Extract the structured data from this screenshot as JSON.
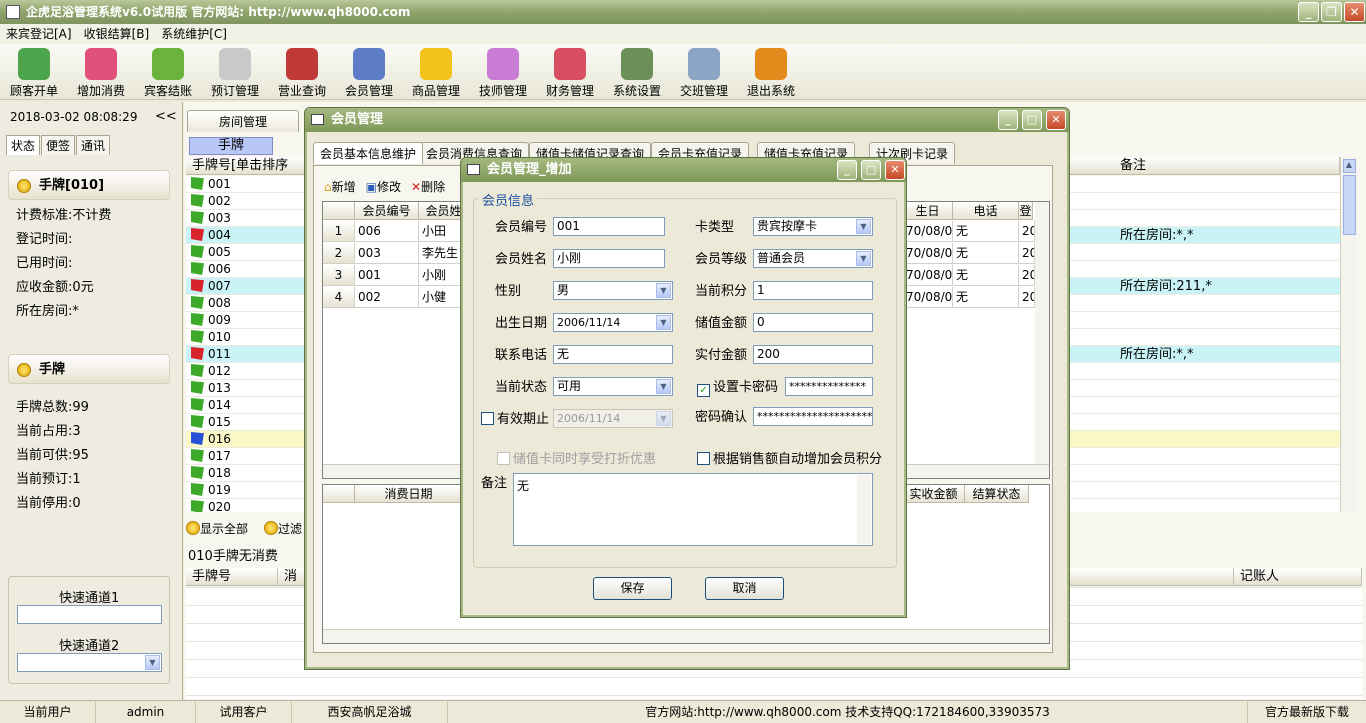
{
  "app": {
    "title": "企虎足浴管理系统v6.0试用版 官方网站: http://www.qh8000.com"
  },
  "menu": [
    "来宾登记[A]",
    "收银结算[B]",
    "系统维护[C]"
  ],
  "toolbar": [
    {
      "label": "顾客开单",
      "icon": "customer-icon",
      "color": "#4CA54C"
    },
    {
      "label": "增加消费",
      "icon": "add-consume-icon",
      "color": "#E0507A"
    },
    {
      "label": "宾客结账",
      "icon": "checkout-icon",
      "color": "#6BB33A"
    },
    {
      "label": "预订管理",
      "icon": "clock-icon",
      "color": "#C9C9C9"
    },
    {
      "label": "营业查询",
      "icon": "query-icon",
      "color": "#C03A3A"
    },
    {
      "label": "会员管理",
      "icon": "members-icon",
      "color": "#5D7DC8"
    },
    {
      "label": "商品管理",
      "icon": "star-icon",
      "color": "#F3C21B"
    },
    {
      "label": "技师管理",
      "icon": "technician-icon",
      "color": "#C87CD4"
    },
    {
      "label": "财务管理",
      "icon": "finance-icon",
      "color": "#D84F63"
    },
    {
      "label": "系统设置",
      "icon": "settings-icon",
      "color": "#6A8F58"
    },
    {
      "label": "交班管理",
      "icon": "handshake-icon",
      "color": "#8DA5C4"
    },
    {
      "label": "退出系统",
      "icon": "exit-icon",
      "color": "#E28A1B"
    }
  ],
  "left": {
    "datetime": "2018-03-02 08:08:29",
    "collapse": "<<",
    "tabs": [
      "状态",
      "便签",
      "通讯"
    ],
    "card1": {
      "title": "手牌[010]",
      "lines": [
        "计费标准:不计费",
        "登记时间:",
        "已用时间:",
        "应收金额:0元",
        "所在房间:*"
      ]
    },
    "card2": {
      "title": "手牌",
      "lines": [
        "手牌总数:99",
        "当前占用:3",
        "当前可供:95",
        "当前预订:1",
        "当前停用:0"
      ]
    },
    "quick1": "快速通道1",
    "quick2": "快速通道2"
  },
  "main": {
    "tab_room": "房间管理",
    "tab_hand": "手牌",
    "col_handno": "手牌号[单击排序",
    "col_remark": "备注",
    "rows": [
      {
        "no": "001",
        "flag": "#3CAA28",
        "hl": "",
        "remark": ""
      },
      {
        "no": "002",
        "flag": "#3CAA28",
        "hl": "",
        "remark": ""
      },
      {
        "no": "003",
        "flag": "#3CAA28",
        "hl": "",
        "remark": ""
      },
      {
        "no": "004",
        "flag": "#D8242A",
        "hl": "#C9F3F6",
        "remark": "所在房间:*,*"
      },
      {
        "no": "005",
        "flag": "#3CAA28",
        "hl": "",
        "remark": ""
      },
      {
        "no": "006",
        "flag": "#3CAA28",
        "hl": "",
        "remark": ""
      },
      {
        "no": "007",
        "flag": "#D8242A",
        "hl": "#C9F3F6",
        "remark": "所在房间:211,*"
      },
      {
        "no": "008",
        "flag": "#3CAA28",
        "hl": "",
        "remark": ""
      },
      {
        "no": "009",
        "flag": "#3CAA28",
        "hl": "",
        "remark": ""
      },
      {
        "no": "010",
        "flag": "#3CAA28",
        "hl": "",
        "remark": ""
      },
      {
        "no": "011",
        "flag": "#D8242A",
        "hl": "#C9F3F6",
        "remark": "所在房间:*,*"
      },
      {
        "no": "012",
        "flag": "#3CAA28",
        "hl": "",
        "remark": ""
      },
      {
        "no": "013",
        "flag": "#3CAA28",
        "hl": "",
        "remark": ""
      },
      {
        "no": "014",
        "flag": "#3CAA28",
        "hl": "",
        "remark": ""
      },
      {
        "no": "015",
        "flag": "#3CAA28",
        "hl": "",
        "remark": ""
      },
      {
        "no": "016",
        "flag": "#2752D8",
        "hl": "#FBF8C8",
        "remark": ""
      },
      {
        "no": "017",
        "flag": "#3CAA28",
        "hl": "",
        "remark": ""
      },
      {
        "no": "018",
        "flag": "#3CAA28",
        "hl": "",
        "remark": ""
      },
      {
        "no": "019",
        "flag": "#3CAA28",
        "hl": "",
        "remark": ""
      },
      {
        "no": "020",
        "flag": "#3CAA28",
        "hl": "",
        "remark": ""
      }
    ],
    "show_all": "显示全部",
    "filter": "过滤",
    "no_consume": "010手牌无消费",
    "bottom_cols": [
      "手牌号",
      "消",
      "记账人"
    ]
  },
  "member_dialog": {
    "title": "会员管理",
    "tabs": [
      "会员基本信息维护",
      "会员消费信息查询",
      "储值卡储值记录查询",
      "会员卡充值记录",
      "储值卡充值记录",
      "计次刷卡记录"
    ],
    "actions": [
      "新增",
      "修改",
      "删除"
    ],
    "cols": [
      "会员编号",
      "会员姓",
      "生日",
      "电话",
      "登"
    ],
    "rows": [
      {
        "idx": "1",
        "id": "006",
        "name": "小田",
        "birth": "70/08/08",
        "phone": "无",
        "x": "20"
      },
      {
        "idx": "2",
        "id": "003",
        "name": "李先生",
        "birth": "70/08/08",
        "phone": "无",
        "x": "20"
      },
      {
        "idx": "3",
        "id": "001",
        "name": "小刚",
        "birth": "70/08/08",
        "phone": "无",
        "x": "20"
      },
      {
        "idx": "4",
        "id": "002",
        "name": "小健",
        "birth": "70/08/08",
        "phone": "无",
        "x": "20"
      }
    ],
    "bottom_cols": [
      "消费日期",
      "实收金额",
      "结算状态"
    ]
  },
  "add_dialog": {
    "title": "会员管理_增加",
    "group": "会员信息",
    "f_id_l": "会员编号",
    "f_id_v": "001",
    "f_name_l": "会员姓名",
    "f_name_v": "小刚",
    "f_sex_l": "性别",
    "f_sex_v": "男",
    "f_birth_l": "出生日期",
    "f_birth_v": "2006/11/14",
    "f_phone_l": "联系电话",
    "f_phone_v": "无",
    "f_state_l": "当前状态",
    "f_state_v": "可用",
    "f_exp_l": "有效期止",
    "f_exp_v": "2006/11/14",
    "f_type_l": "卡类型",
    "f_type_v": "贵宾按摩卡",
    "f_level_l": "会员等级",
    "f_level_v": "普通会员",
    "f_points_l": "当前积分",
    "f_points_v": "1",
    "f_stored_l": "储值金额",
    "f_stored_v": "0",
    "f_paid_l": "实付金额",
    "f_paid_v": "200",
    "f_pwd_l": "设置卡密码",
    "f_pwd_v": "**************",
    "f_pwd2_l": "密码确认",
    "f_pwd2_v": "**********************",
    "f_disc_l": "储值卡同时享受打折优惠",
    "f_auto_l": "根据销售额自动增加会员积分",
    "f_remark_l": "备注",
    "f_remark_v": "无",
    "save": "保存",
    "cancel": "取消"
  },
  "status": {
    "user_l": "当前用户",
    "user": "admin",
    "client": "试用客户",
    "shop": "西安高帆足浴城",
    "site": "官方网站:http://www.qh8000.com 技术支持QQ:172184600,33903573",
    "dl": "官方最新版下载"
  }
}
